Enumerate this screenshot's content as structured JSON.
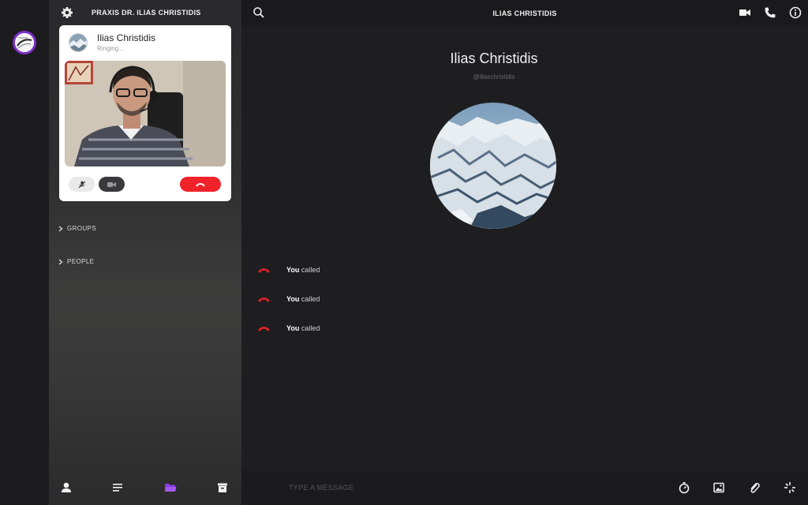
{
  "sidebar": {
    "title": "PRAXIS DR. ILIAS CHRISTIDIS",
    "sections": [
      {
        "label": "GROUPS"
      },
      {
        "label": "PEOPLE"
      }
    ]
  },
  "call_card": {
    "name": "Ilias Christidis",
    "status": "Ringing..."
  },
  "conversation": {
    "header_title": "ILIAS CHRISTIDIS",
    "name": "Ilias Christidis",
    "handle": "@iliaschristidis",
    "messages": [
      {
        "actor": "You",
        "action": "called"
      },
      {
        "actor": "You",
        "action": "called"
      },
      {
        "actor": "You",
        "action": "called"
      }
    ]
  },
  "composer": {
    "placeholder": "TYPE A MESSAGE"
  },
  "colors": {
    "accent": "#7b2fc9",
    "hangup": "#f0222a",
    "missed_call": "#e02027"
  }
}
